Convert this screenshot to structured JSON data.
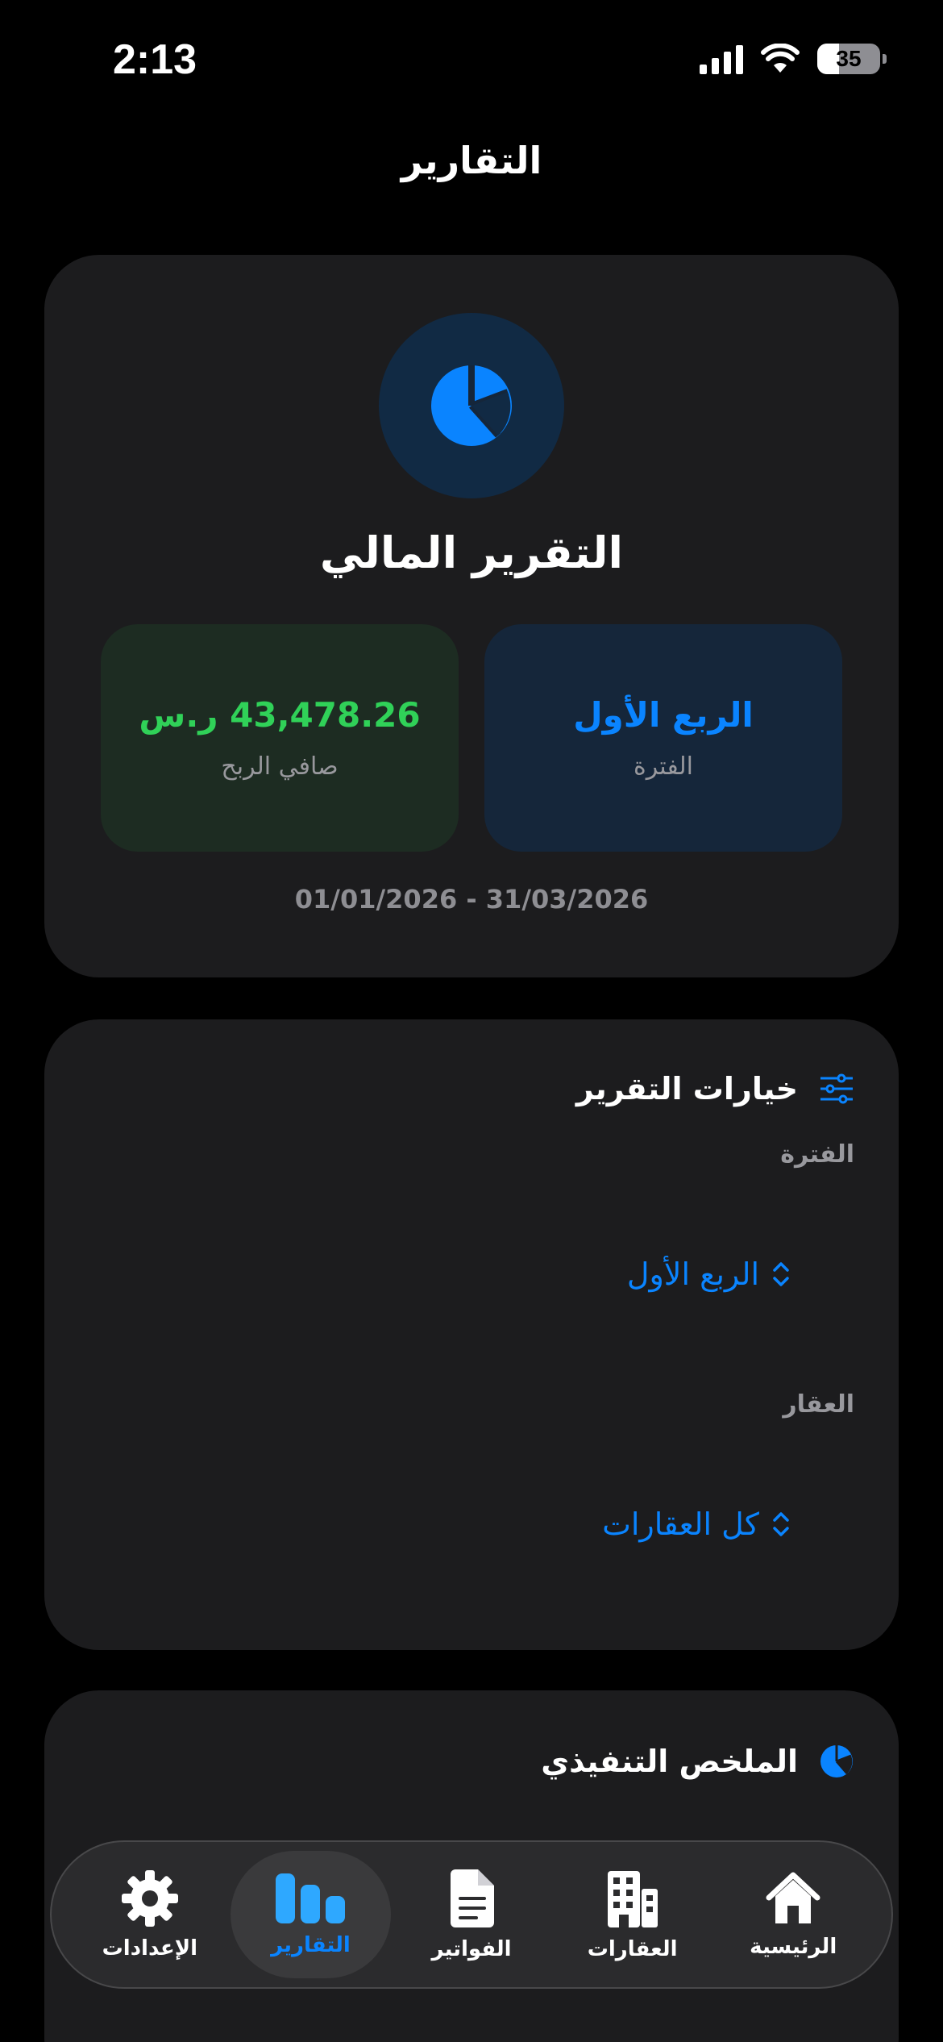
{
  "status_bar": {
    "time": "2:13",
    "battery": "35"
  },
  "nav": {
    "title": "التقارير"
  },
  "report_card": {
    "icon": "pie-chart-icon",
    "title": "التقرير المالي",
    "period_value": "الربع الأول",
    "period_label": "الفترة",
    "profit_value": "43,478.26 ر.س",
    "profit_label": "صافي الربح",
    "date_range": "01/01/2026 - 31/03/2026"
  },
  "options_card": {
    "icon": "sliders-icon",
    "title": "خيارات التقرير",
    "period_label": "الفترة",
    "period_value": "الربع الأول",
    "property_label": "العقار",
    "property_value": "كل العقارات"
  },
  "summary_card": {
    "icon": "pie-chart-icon",
    "title": "الملخص التنفيذي"
  },
  "tab_bar": {
    "items": [
      {
        "label": "الرئيسية",
        "icon": "house-icon"
      },
      {
        "label": "العقارات",
        "icon": "building-icon"
      },
      {
        "label": "الفواتير",
        "icon": "document-icon"
      },
      {
        "label": "التقارير",
        "icon": "bar-chart-icon",
        "active": true
      },
      {
        "label": "الإعدادات",
        "icon": "gear-icon"
      }
    ]
  },
  "colors": {
    "accent": "#0a84ff",
    "profit_green": "#30d158",
    "card": "#1c1c1e",
    "background": "#000000"
  }
}
